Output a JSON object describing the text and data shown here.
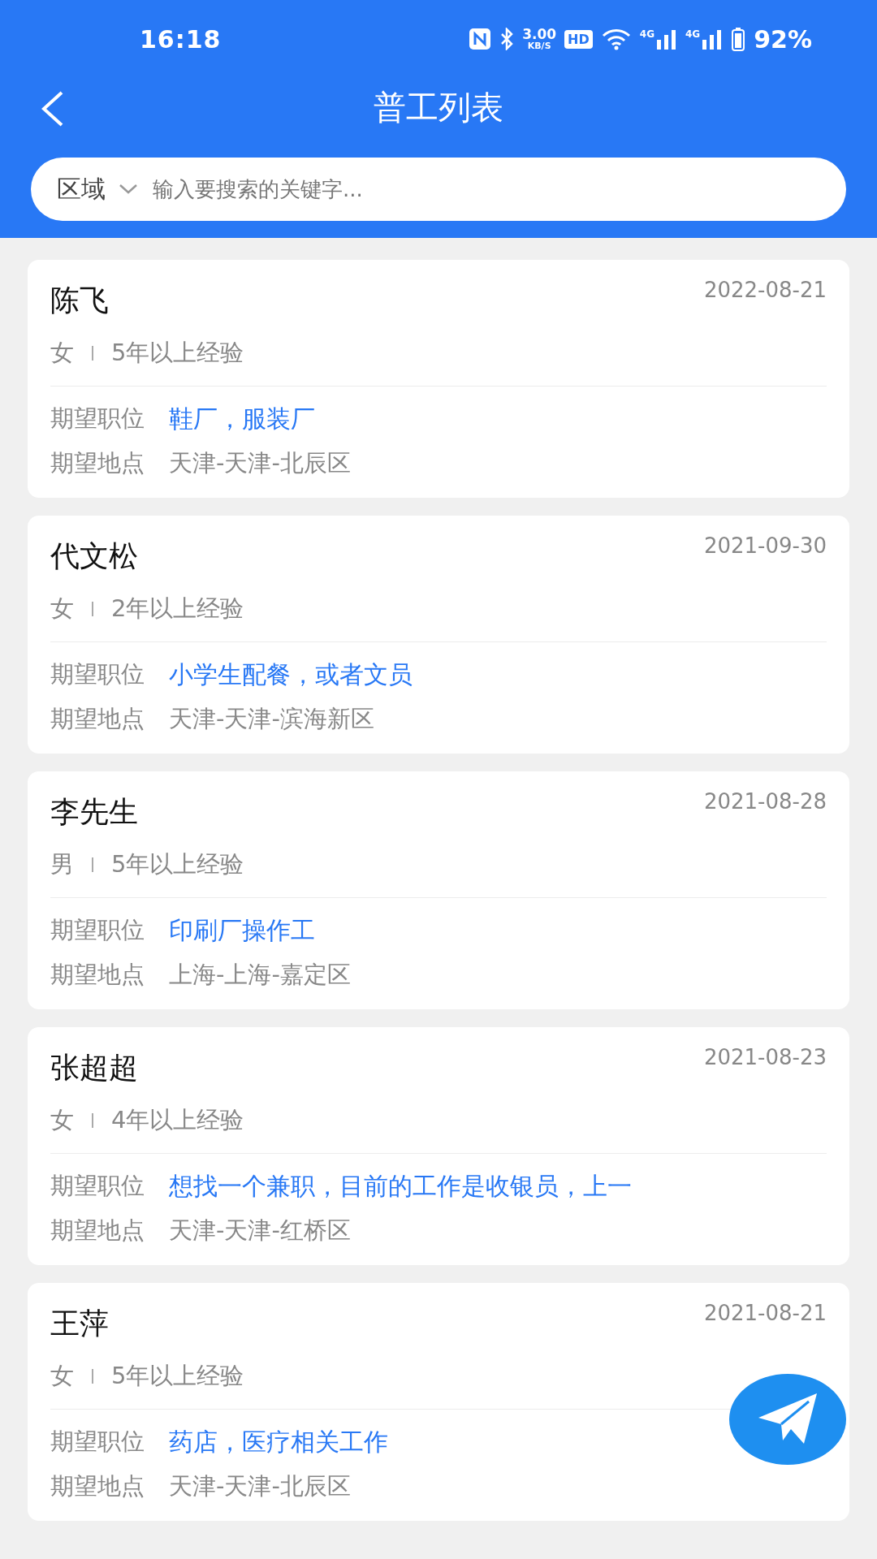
{
  "status_bar": {
    "time": "16:18",
    "speed": "3.00",
    "speed_unit": "KB/S",
    "hd": "HD",
    "networks": [
      "4G",
      "4G"
    ],
    "battery": "92%"
  },
  "header": {
    "title": "普工列表"
  },
  "search": {
    "region": "区域",
    "placeholder": "输入要搜索的关键字..."
  },
  "workers": [
    {
      "name": "陈飞",
      "date": "2022-08-21",
      "gender": "女",
      "experience": "5年以上经验",
      "position_label": "期望职位",
      "position": "鞋厂，服装厂",
      "location_label": "期望地点",
      "location": "天津-天津-北辰区"
    },
    {
      "name": "代文松",
      "date": "2021-09-30",
      "gender": "女",
      "experience": "2年以上经验",
      "position_label": "期望职位",
      "position": "小学生配餐，或者文员",
      "location_label": "期望地点",
      "location": "天津-天津-滨海新区"
    },
    {
      "name": "李先生",
      "date": "2021-08-28",
      "gender": "男",
      "experience": "5年以上经验",
      "position_label": "期望职位",
      "position": "印刷厂操作工",
      "location_label": "期望地点",
      "location": "上海-上海-嘉定区"
    },
    {
      "name": "张超超",
      "date": "2021-08-23",
      "gender": "女",
      "experience": "4年以上经验",
      "position_label": "期望职位",
      "position": "想找一个兼职，目前的工作是收银员，上一",
      "location_label": "期望地点",
      "location": "天津-天津-红桥区"
    },
    {
      "name": "王萍",
      "date": "2021-08-21",
      "gender": "女",
      "experience": "5年以上经验",
      "position_label": "期望职位",
      "position": "药店，医疗相关工作",
      "location_label": "期望地点",
      "location": "天津-天津-北辰区"
    }
  ]
}
